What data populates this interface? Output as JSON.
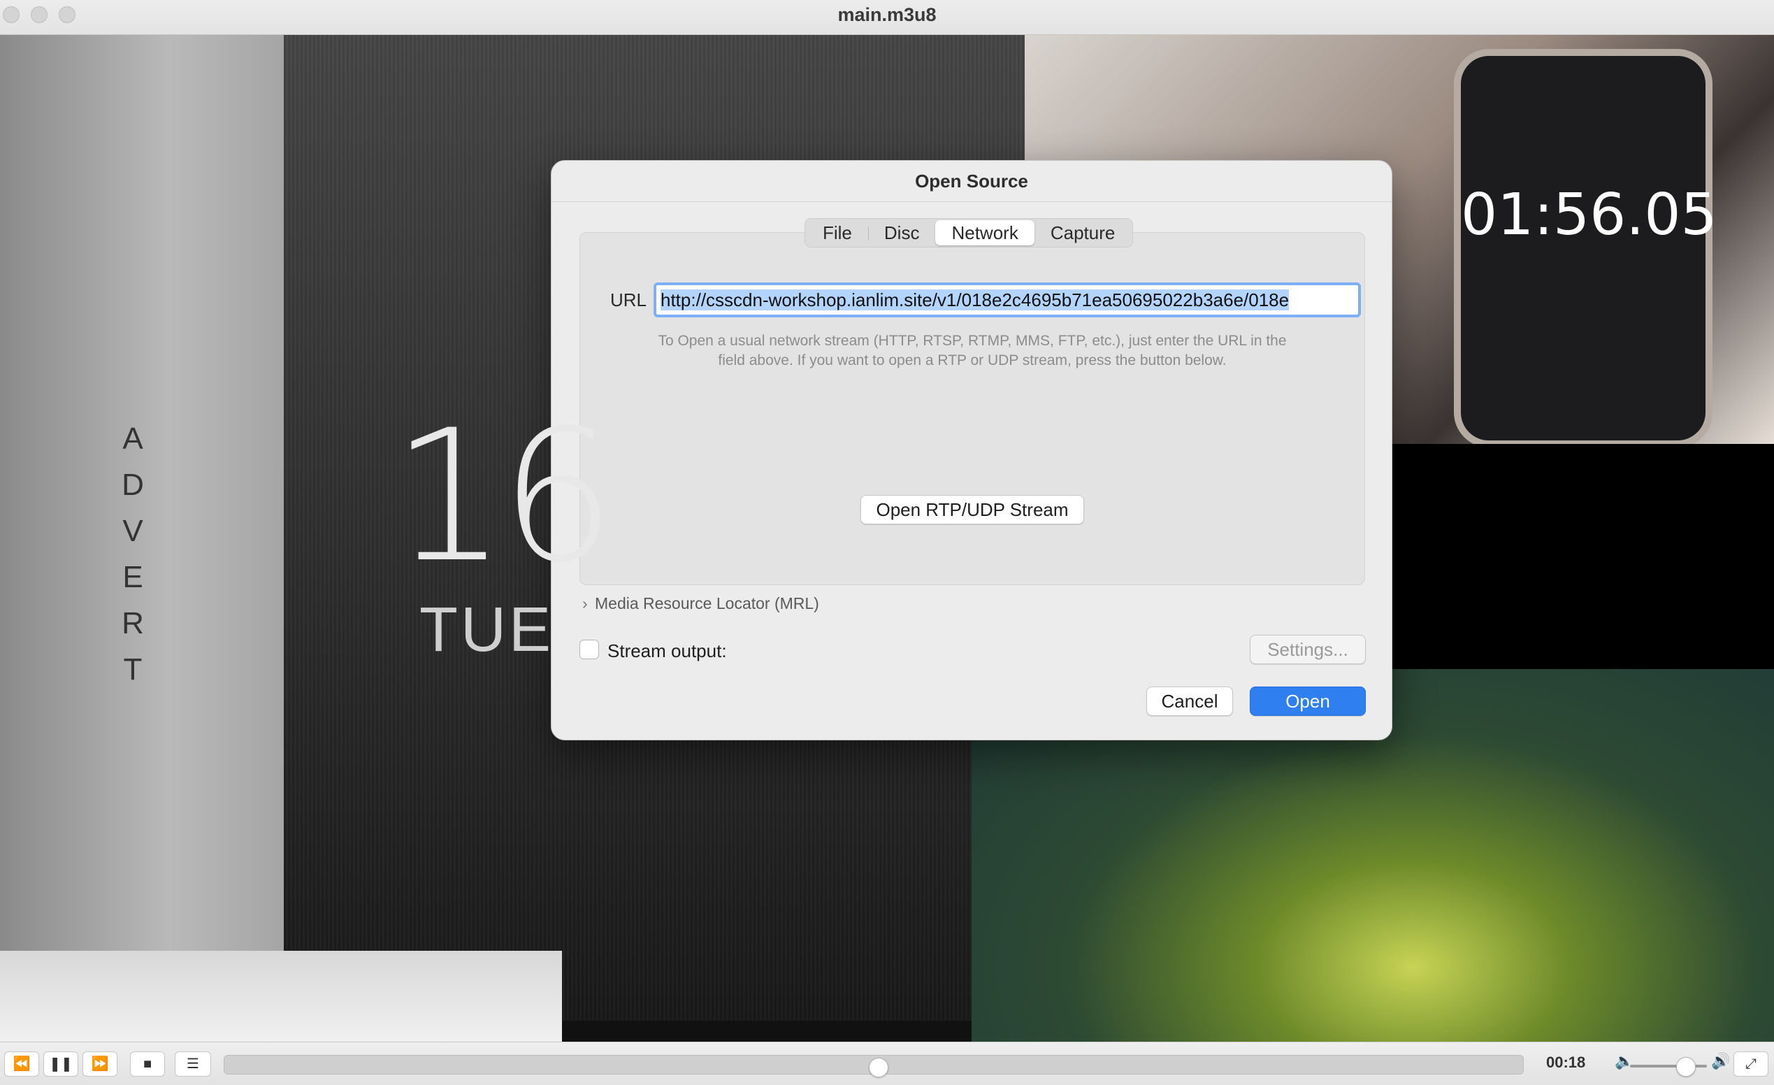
{
  "window": {
    "title": "main.m3u8"
  },
  "video": {
    "advert_text": "ADVERT",
    "big_number": "16",
    "day_text": "TUE",
    "phone_time": "01:56.05"
  },
  "dialog": {
    "title": "Open Source",
    "tabs": [
      {
        "label": "File",
        "active": false
      },
      {
        "label": "Disc",
        "active": false
      },
      {
        "label": "Network",
        "active": true
      },
      {
        "label": "Capture",
        "active": false
      }
    ],
    "url_label": "URL",
    "url_value": "http://csscdn-workshop.ianlim.site/v1/018e2c4695b71ea50695022b3a6e/018e",
    "hint_line1": "To Open a usual network stream (HTTP, RTSP, RTMP, MMS, FTP, etc.), just enter the URL in the",
    "hint_line2": "field above. If you want to open a RTP or UDP stream, press the button below.",
    "rtp_button": "Open RTP/UDP Stream",
    "mrl_label": "Media Resource Locator (MRL)",
    "stream_output_label": "Stream output:",
    "stream_output_checked": false,
    "settings_button": "Settings...",
    "cancel_button": "Cancel",
    "open_button": "Open"
  },
  "controls": {
    "time": "00:18",
    "seek_progress": 0.504,
    "volume_level": 0.73,
    "icons": {
      "rewind": "⏪",
      "pause": "❚❚",
      "forward": "⏩",
      "stop": "■",
      "playlist": "☰",
      "volume_low": "🔈",
      "volume_high": "🔊",
      "fullscreen": "⤢"
    }
  },
  "colors": {
    "accent": "#2f7ff0",
    "focus_ring": "#7fb0f5",
    "selection": "#b3d4ff"
  }
}
